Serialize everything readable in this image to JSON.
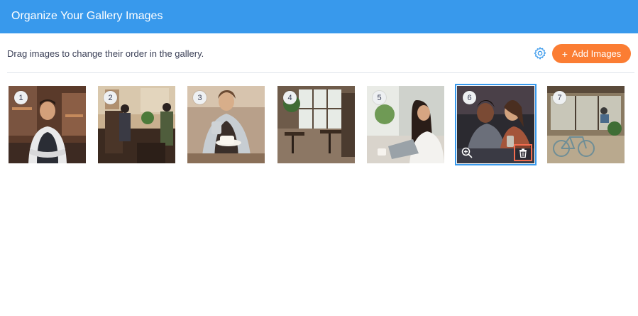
{
  "header": {
    "title": "Organize Your Gallery Images"
  },
  "toolbar": {
    "instructions": "Drag images to change their order in the gallery.",
    "settings_icon": "gear-icon",
    "add_button_icon": "+",
    "add_button_label": "Add Images"
  },
  "colors": {
    "header": "#3899ec",
    "accent_button": "#fb7d33",
    "selected_outline": "#3899ec",
    "delete_highlight": "#f26c4f"
  },
  "gallery": {
    "images": [
      {
        "number": "1",
        "subject": "barista-portrait"
      },
      {
        "number": "2",
        "subject": "cafe-street-entrance"
      },
      {
        "number": "3",
        "subject": "barista-pouring-latte"
      },
      {
        "number": "4",
        "subject": "cafe-interior"
      },
      {
        "number": "5",
        "subject": "woman-with-laptop"
      },
      {
        "number": "6",
        "subject": "people-talking-at-table",
        "selected": true,
        "actions": [
          "zoom-icon",
          "trash-icon"
        ]
      },
      {
        "number": "7",
        "subject": "cafe-storefront-with-bicycle"
      }
    ]
  }
}
